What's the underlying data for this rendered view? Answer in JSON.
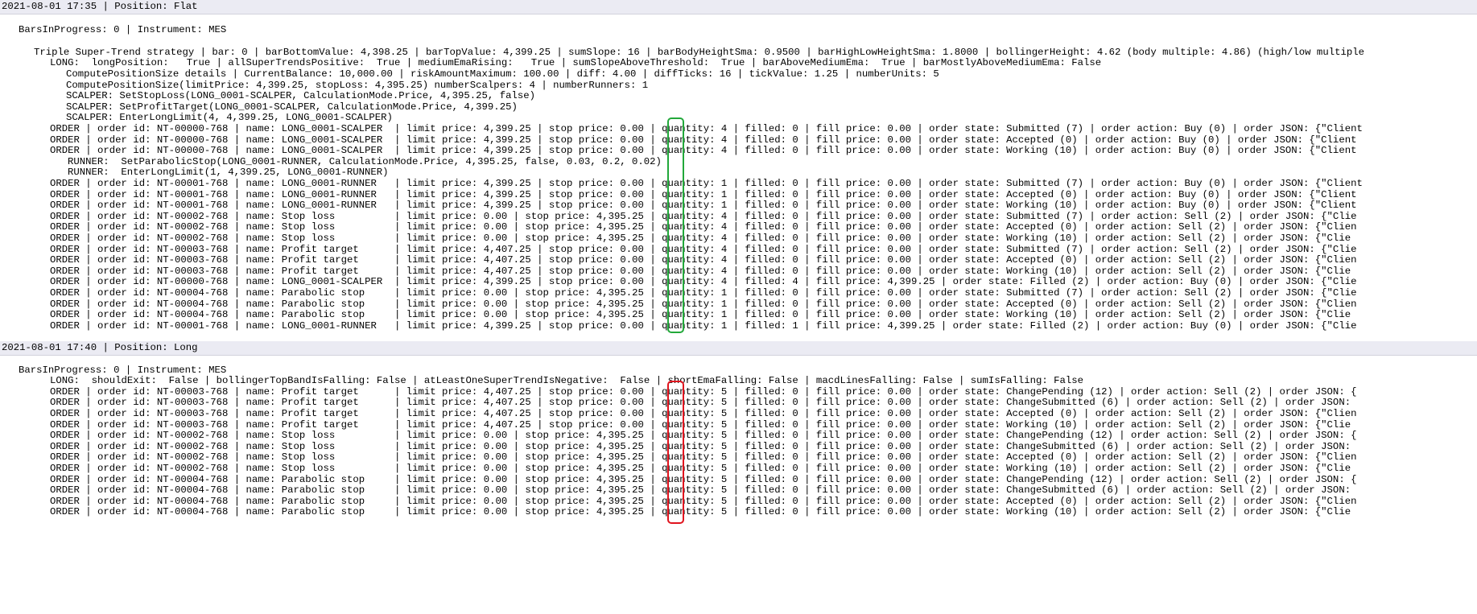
{
  "log": {
    "sessions": [
      {
        "header": "2021-08-01 17:35 | Position: Flat",
        "lines": [
          "BarsInProgress: 0 | Instrument: MES",
          "Triple Super-Trend strategy | bar: 0 | barBottomValue: 4,398.25 | barTopValue: 4,399.25 | sumSlope: 16 | barBodyHeightSma: 0.9500 | barHighLowHeightSma: 1.8000 | bollingerHeight: 4.62 (body multiple: 4.86) (high/low multiple",
          "LONG:  longPosition:   True | allSuperTrendsPositive:  True | mediumEmaRising:   True | sumSlopeAboveThreshold:  True | barAboveMediumEma:  True | barMostlyAboveMediumEma: False",
          "ComputePositionSize details | CurrentBalance: 10,000.00 | riskAmountMaximum: 100.00 | diff: 4.00 | diffTicks: 16 | tickValue: 1.25 | numberUnits: 5",
          "ComputePositionSize(limitPrice: 4,399.25, stopLoss: 4,395.25) numberScalpers: 4 | numberRunners: 1",
          "SCALPER: SetStopLoss(LONG_0001-SCALPER, CalculationMode.Price, 4,395.25, false)",
          "SCALPER: SetProfitTarget(LONG_0001-SCALPER, CalculationMode.Price, 4,399.25)",
          "SCALPER: EnterLongLimit(4, 4,399.25, LONG_0001-SCALPER)",
          "ORDER | order id: NT-00000-768 | name: LONG_0001-SCALPER  | limit price: 4,399.25 | stop price: 0.00 | quantity: 4 | filled: 0 | fill price: 0.00 | order state: Submitted (7) | order action: Buy (0) | order JSON: {\"Client",
          "ORDER | order id: NT-00000-768 | name: LONG_0001-SCALPER  | limit price: 4,399.25 | stop price: 0.00 | quantity: 4 | filled: 0 | fill price: 0.00 | order state: Accepted (0) | order action: Buy (0) | order JSON: {\"Client",
          "ORDER | order id: NT-00000-768 | name: LONG_0001-SCALPER  | limit price: 4,399.25 | stop price: 0.00 | quantity: 4 | filled: 0 | fill price: 0.00 | order state: Working (10) | order action: Buy (0) | order JSON: {\"Client",
          "RUNNER:  SetParabolicStop(LONG_0001-RUNNER, CalculationMode.Price, 4,395.25, false, 0.03, 0.2, 0.02)",
          "RUNNER:  EnterLongLimit(1, 4,399.25, LONG_0001-RUNNER)",
          "ORDER | order id: NT-00001-768 | name: LONG_0001-RUNNER   | limit price: 4,399.25 | stop price: 0.00 | quantity: 1 | filled: 0 | fill price: 0.00 | order state: Submitted (7) | order action: Buy (0) | order JSON: {\"Client",
          "ORDER | order id: NT-00001-768 | name: LONG_0001-RUNNER   | limit price: 4,399.25 | stop price: 0.00 | quantity: 1 | filled: 0 | fill price: 0.00 | order state: Accepted (0) | order action: Buy (0) | order JSON: {\"Client",
          "ORDER | order id: NT-00001-768 | name: LONG_0001-RUNNER   | limit price: 4,399.25 | stop price: 0.00 | quantity: 1 | filled: 0 | fill price: 0.00 | order state: Working (10) | order action: Buy (0) | order JSON: {\"Client",
          "ORDER | order id: NT-00002-768 | name: Stop loss          | limit price: 0.00 | stop price: 4,395.25 | quantity: 4 | filled: 0 | fill price: 0.00 | order state: Submitted (7) | order action: Sell (2) | order JSON: {\"Clie",
          "ORDER | order id: NT-00002-768 | name: Stop loss          | limit price: 0.00 | stop price: 4,395.25 | quantity: 4 | filled: 0 | fill price: 0.00 | order state: Accepted (0) | order action: Sell (2) | order JSON: {\"Clien",
          "ORDER | order id: NT-00002-768 | name: Stop loss          | limit price: 0.00 | stop price: 4,395.25 | quantity: 4 | filled: 0 | fill price: 0.00 | order state: Working (10) | order action: Sell (2) | order JSON: {\"Clie",
          "ORDER | order id: NT-00003-768 | name: Profit target      | limit price: 4,407.25 | stop price: 0.00 | quantity: 4 | filled: 0 | fill price: 0.00 | order state: Submitted (7) | order action: Sell (2) | order JSON: {\"Clie",
          "ORDER | order id: NT-00003-768 | name: Profit target      | limit price: 4,407.25 | stop price: 0.00 | quantity: 4 | filled: 0 | fill price: 0.00 | order state: Accepted (0) | order action: Sell (2) | order JSON: {\"Clien",
          "ORDER | order id: NT-00003-768 | name: Profit target      | limit price: 4,407.25 | stop price: 0.00 | quantity: 4 | filled: 0 | fill price: 0.00 | order state: Working (10) | order action: Sell (2) | order JSON: {\"Clie",
          "ORDER | order id: NT-00000-768 | name: LONG_0001-SCALPER  | limit price: 4,399.25 | stop price: 0.00 | quantity: 4 | filled: 4 | fill price: 4,399.25 | order state: Filled (2) | order action: Buy (0) | order JSON: {\"Clie",
          "ORDER | order id: NT-00004-768 | name: Parabolic stop     | limit price: 0.00 | stop price: 4,395.25 | quantity: 1 | filled: 0 | fill price: 0.00 | order state: Submitted (7) | order action: Sell (2) | order JSON: {\"Clie",
          "ORDER | order id: NT-00004-768 | name: Parabolic stop     | limit price: 0.00 | stop price: 4,395.25 | quantity: 1 | filled: 0 | fill price: 0.00 | order state: Accepted (0) | order action: Sell (2) | order JSON: {\"Clien",
          "ORDER | order id: NT-00004-768 | name: Parabolic stop     | limit price: 0.00 | stop price: 4,395.25 | quantity: 1 | filled: 0 | fill price: 0.00 | order state: Working (10) | order action: Sell (2) | order JSON: {\"Clie",
          "ORDER | order id: NT-00001-768 | name: LONG_0001-RUNNER   | limit price: 4,399.25 | stop price: 0.00 | quantity: 1 | filled: 1 | fill price: 4,399.25 | order state: Filled (2) | order action: Buy (0) | order JSON: {\"Clie"
        ]
      },
      {
        "header": "2021-08-01 17:40 | Position: Long",
        "lines": [
          "BarsInProgress: 0 | Instrument: MES",
          "LONG:  shouldExit:  False | bollingerTopBandIsFalling: False | atLeastOneSuperTrendIsNegative:  False | shortEmaFalling: False | macdLinesFalling: False | sumIsFalling: False",
          "ORDER | order id: NT-00003-768 | name: Profit target      | limit price: 4,407.25 | stop price: 0.00 | quantity: 5 | filled: 0 | fill price: 0.00 | order state: ChangePending (12) | order action: Sell (2) | order JSON: {",
          "ORDER | order id: NT-00003-768 | name: Profit target      | limit price: 4,407.25 | stop price: 0.00 | quantity: 5 | filled: 0 | fill price: 0.00 | order state: ChangeSubmitted (6) | order action: Sell (2) | order JSON:",
          "ORDER | order id: NT-00003-768 | name: Profit target      | limit price: 4,407.25 | stop price: 0.00 | quantity: 5 | filled: 0 | fill price: 0.00 | order state: Accepted (0) | order action: Sell (2) | order JSON: {\"Clien",
          "ORDER | order id: NT-00003-768 | name: Profit target      | limit price: 4,407.25 | stop price: 0.00 | quantity: 5 | filled: 0 | fill price: 0.00 | order state: Working (10) | order action: Sell (2) | order JSON: {\"Clie",
          "ORDER | order id: NT-00002-768 | name: Stop loss          | limit price: 0.00 | stop price: 4,395.25 | quantity: 5 | filled: 0 | fill price: 0.00 | order state: ChangePending (12) | order action: Sell (2) | order JSON: {",
          "ORDER | order id: NT-00002-768 | name: Stop loss          | limit price: 0.00 | stop price: 4,395.25 | quantity: 5 | filled: 0 | fill price: 0.00 | order state: ChangeSubmitted (6) | order action: Sell (2) | order JSON:",
          "ORDER | order id: NT-00002-768 | name: Stop loss          | limit price: 0.00 | stop price: 4,395.25 | quantity: 5 | filled: 0 | fill price: 0.00 | order state: Accepted (0) | order action: Sell (2) | order JSON: {\"Clien",
          "ORDER | order id: NT-00002-768 | name: Stop loss          | limit price: 0.00 | stop price: 4,395.25 | quantity: 5 | filled: 0 | fill price: 0.00 | order state: Working (10) | order action: Sell (2) | order JSON: {\"Clie",
          "ORDER | order id: NT-00004-768 | name: Parabolic stop     | limit price: 0.00 | stop price: 4,395.25 | quantity: 5 | filled: 0 | fill price: 0.00 | order state: ChangePending (12) | order action: Sell (2) | order JSON: {",
          "ORDER | order id: NT-00004-768 | name: Parabolic stop     | limit price: 0.00 | stop price: 4,395.25 | quantity: 5 | filled: 0 | fill price: 0.00 | order state: ChangeSubmitted (6) | order action: Sell (2) | order JSON:",
          "ORDER | order id: NT-00004-768 | name: Parabolic stop     | limit price: 0.00 | stop price: 4,395.25 | quantity: 5 | filled: 0 | fill price: 0.00 | order state: Accepted (0) | order action: Sell (2) | order JSON: {\"Clien",
          "ORDER | order id: NT-00004-768 | name: Parabolic stop     | limit price: 0.00 | stop price: 4,395.25 | quantity: 5 | filled: 0 | fill price: 0.00 | order state: Working (10) | order action: Sell (2) | order JSON: {\"Clie"
        ]
      }
    ]
  },
  "highlights": {
    "first_box_color": "#22a83a",
    "second_box_color": "#e0141e"
  }
}
